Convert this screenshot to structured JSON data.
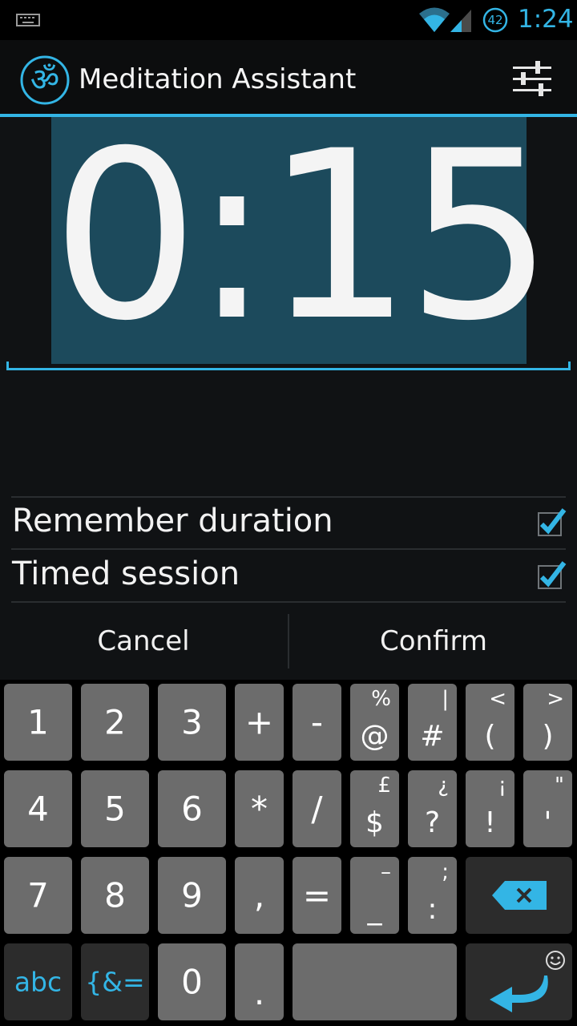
{
  "status_bar": {
    "battery_level": "42",
    "time": "1:24",
    "icons": [
      "keyboard-icon",
      "wifi-icon",
      "signal-icon",
      "battery-icon"
    ]
  },
  "action_bar": {
    "app_title": "Meditation Assistant",
    "logo_icon": "om-icon",
    "settings_icon": "sliders-icon"
  },
  "timer": {
    "value": "0:15"
  },
  "options": [
    {
      "label": "Remember duration",
      "checked": true
    },
    {
      "label": "Timed session",
      "checked": true
    }
  ],
  "buttons": {
    "cancel": "Cancel",
    "confirm": "Confirm"
  },
  "keyboard": {
    "rows": [
      [
        {
          "main": "1",
          "sub": ""
        },
        {
          "main": "2",
          "sub": ""
        },
        {
          "main": "3",
          "sub": ""
        },
        {
          "main": "+",
          "sub": ""
        },
        {
          "main": "-",
          "sub": ""
        },
        {
          "main": "@",
          "sub": "%"
        },
        {
          "main": "#",
          "sub": "|"
        },
        {
          "main": "(",
          "sub": "<"
        },
        {
          "main": ")",
          "sub": ">"
        }
      ],
      [
        {
          "main": "4",
          "sub": ""
        },
        {
          "main": "5",
          "sub": ""
        },
        {
          "main": "6",
          "sub": ""
        },
        {
          "main": "*",
          "sub": ""
        },
        {
          "main": "/",
          "sub": ""
        },
        {
          "main": "$",
          "sub": "£"
        },
        {
          "main": "?",
          "sub": "¿"
        },
        {
          "main": "!",
          "sub": "¡"
        },
        {
          "main": "'",
          "sub": "\""
        }
      ],
      [
        {
          "main": "7",
          "sub": ""
        },
        {
          "main": "8",
          "sub": ""
        },
        {
          "main": "9",
          "sub": ""
        },
        {
          "main": ",",
          "sub": ""
        },
        {
          "main": "=",
          "sub": ""
        },
        {
          "main": "_",
          "sub": "–"
        },
        {
          "main": ":",
          "sub": ";"
        }
      ],
      [
        {
          "main": "abc",
          "sub": ""
        },
        {
          "main": "{&=",
          "sub": ""
        },
        {
          "main": "0",
          "sub": ""
        },
        {
          "main": ".",
          "sub": ""
        }
      ]
    ],
    "accent_color": "#33b5e5"
  },
  "colors": {
    "accent": "#33b5e5",
    "timer_bg": "#1c4a5c",
    "key_bg": "#6c6c6c",
    "key_dark_bg": "#2c2c2c"
  }
}
